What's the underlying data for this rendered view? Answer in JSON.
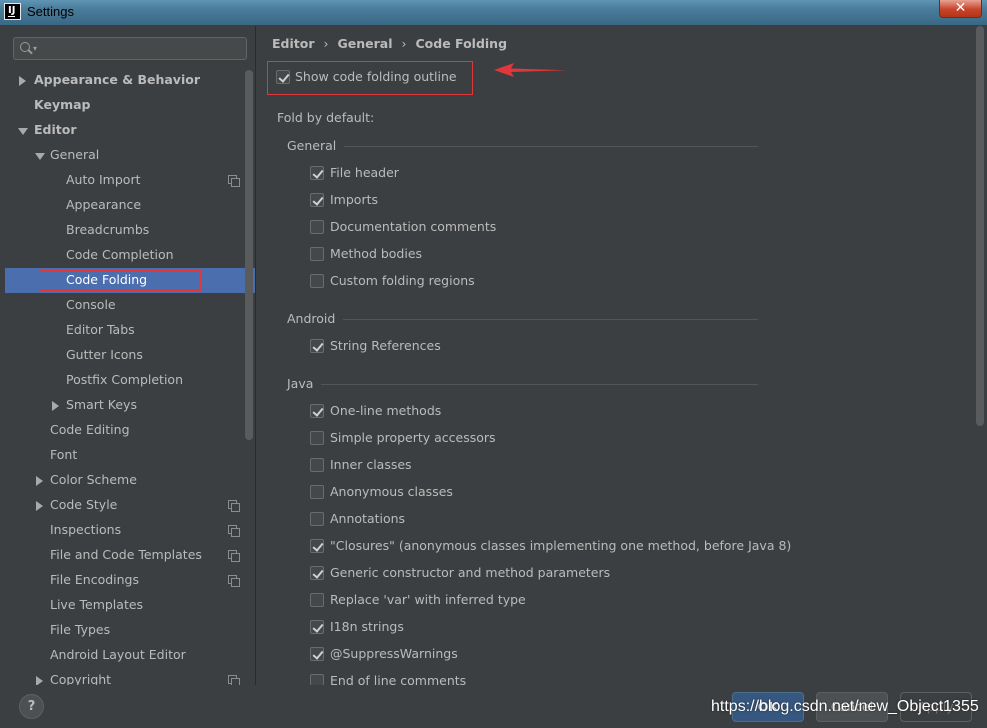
{
  "window": {
    "title": "Settings",
    "app_icon_text": "IJ"
  },
  "search": {
    "placeholder": ""
  },
  "tree": [
    {
      "label": "Appearance & Behavior",
      "depth": 0,
      "bold": true,
      "arrow": "right"
    },
    {
      "label": "Keymap",
      "depth": 0,
      "bold": true,
      "arrow": ""
    },
    {
      "label": "Editor",
      "depth": 0,
      "bold": true,
      "arrow": "down"
    },
    {
      "label": "General",
      "depth": 1,
      "arrow": "down"
    },
    {
      "label": "Auto Import",
      "depth": 2,
      "arrow": "",
      "copy_icon": true
    },
    {
      "label": "Appearance",
      "depth": 2,
      "arrow": ""
    },
    {
      "label": "Breadcrumbs",
      "depth": 2,
      "arrow": ""
    },
    {
      "label": "Code Completion",
      "depth": 2,
      "arrow": ""
    },
    {
      "label": "Code Folding",
      "depth": 2,
      "arrow": "",
      "selected": true
    },
    {
      "label": "Console",
      "depth": 2,
      "arrow": ""
    },
    {
      "label": "Editor Tabs",
      "depth": 2,
      "arrow": ""
    },
    {
      "label": "Gutter Icons",
      "depth": 2,
      "arrow": ""
    },
    {
      "label": "Postfix Completion",
      "depth": 2,
      "arrow": ""
    },
    {
      "label": "Smart Keys",
      "depth": 2,
      "arrow": "right"
    },
    {
      "label": "Code Editing",
      "depth": 1,
      "arrow": ""
    },
    {
      "label": "Font",
      "depth": 1,
      "arrow": ""
    },
    {
      "label": "Color Scheme",
      "depth": 1,
      "arrow": "right"
    },
    {
      "label": "Code Style",
      "depth": 1,
      "arrow": "right",
      "copy_icon": true
    },
    {
      "label": "Inspections",
      "depth": 1,
      "arrow": "",
      "copy_icon": true
    },
    {
      "label": "File and Code Templates",
      "depth": 1,
      "arrow": "",
      "copy_icon": true
    },
    {
      "label": "File Encodings",
      "depth": 1,
      "arrow": "",
      "copy_icon": true
    },
    {
      "label": "Live Templates",
      "depth": 1,
      "arrow": ""
    },
    {
      "label": "File Types",
      "depth": 1,
      "arrow": ""
    },
    {
      "label": "Android Layout Editor",
      "depth": 1,
      "arrow": ""
    },
    {
      "label": "Copyright",
      "depth": 1,
      "arrow": "right",
      "copy_icon": true
    }
  ],
  "breadcrumb": [
    "Editor",
    "General",
    "Code Folding"
  ],
  "breadcrumb_separator": "›",
  "show_outline": {
    "label": "Show code folding outline",
    "checked": true
  },
  "fold_by_default_label": "Fold by default:",
  "groups": [
    {
      "title": "General",
      "items": [
        {
          "label": "File header",
          "checked": true
        },
        {
          "label": "Imports",
          "checked": true
        },
        {
          "label": "Documentation comments",
          "checked": false
        },
        {
          "label": "Method bodies",
          "checked": false
        },
        {
          "label": "Custom folding regions",
          "checked": false
        }
      ]
    },
    {
      "title": "Android",
      "items": [
        {
          "label": "String References",
          "checked": true
        }
      ]
    },
    {
      "title": "Java",
      "items": [
        {
          "label": "One-line methods",
          "checked": true
        },
        {
          "label": "Simple property accessors",
          "checked": false
        },
        {
          "label": "Inner classes",
          "checked": false
        },
        {
          "label": "Anonymous classes",
          "checked": false
        },
        {
          "label": "Annotations",
          "checked": false
        },
        {
          "label": "\"Closures\" (anonymous classes implementing one method, before Java 8)",
          "checked": true
        },
        {
          "label": "Generic constructor and method parameters",
          "checked": true
        },
        {
          "label": "Replace 'var' with inferred type",
          "checked": false
        },
        {
          "label": "I18n strings",
          "checked": true
        },
        {
          "label": "@SuppressWarnings",
          "checked": true
        },
        {
          "label": "End of line comments",
          "checked": false
        }
      ]
    }
  ],
  "buttons": {
    "help": "?",
    "ok": "OK",
    "cancel": "Cancel",
    "apply": "Apply"
  },
  "watermark": "https://blog.csdn.net/new_Object1355",
  "colors": {
    "selection": "#4b6eaf",
    "annotation_red": "#e0373c",
    "background": "#3c3f41"
  }
}
